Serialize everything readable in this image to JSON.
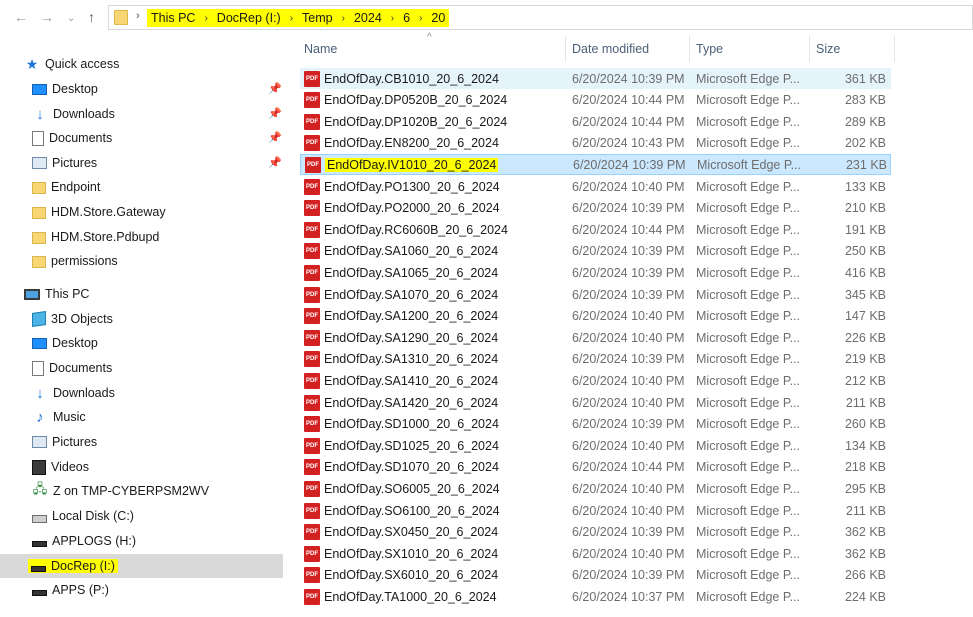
{
  "address_bar": {
    "crumbs": [
      "This PC",
      "DocRep (I:)",
      "Temp",
      "2024",
      "6",
      "20"
    ],
    "separator": "›"
  },
  "nav": {
    "back_icon": "arrow-left-icon",
    "forward_icon": "arrow-right-icon",
    "recent_icon": "chevron-down-icon",
    "up_icon": "arrow-up-icon"
  },
  "sidebar": {
    "quick_access": {
      "label": "Quick access",
      "items": [
        {
          "label": "Desktop",
          "pinned": true,
          "icon": "desktop-icon"
        },
        {
          "label": "Downloads",
          "pinned": true,
          "icon": "downloads-icon"
        },
        {
          "label": "Documents",
          "pinned": true,
          "icon": "documents-icon"
        },
        {
          "label": "Pictures",
          "pinned": true,
          "icon": "pictures-icon"
        },
        {
          "label": "Endpoint",
          "pinned": false,
          "icon": "folder-icon"
        },
        {
          "label": "HDM.Store.Gateway",
          "pinned": false,
          "icon": "folder-icon"
        },
        {
          "label": "HDM.Store.Pdbupd",
          "pinned": false,
          "icon": "folder-icon"
        },
        {
          "label": "permissions",
          "pinned": false,
          "icon": "folder-icon"
        }
      ]
    },
    "this_pc": {
      "label": "This PC",
      "items": [
        {
          "label": "3D Objects",
          "icon": "3d-objects-icon"
        },
        {
          "label": "Desktop",
          "icon": "desktop-icon"
        },
        {
          "label": "Documents",
          "icon": "documents-icon"
        },
        {
          "label": "Downloads",
          "icon": "downloads-icon"
        },
        {
          "label": "Music",
          "icon": "music-icon"
        },
        {
          "label": "Pictures",
          "icon": "pictures-icon"
        },
        {
          "label": "Videos",
          "icon": "videos-icon"
        },
        {
          "label": "Z on TMP-CYBERPSM2WV",
          "icon": "network-drive-icon"
        },
        {
          "label": "Local Disk (C:)",
          "icon": "local-disk-icon"
        },
        {
          "label": "APPLOGS (H:)",
          "icon": "drive-icon"
        },
        {
          "label": "DocRep (I:)",
          "icon": "drive-icon",
          "selected": true
        },
        {
          "label": "APPS (P:)",
          "icon": "drive-icon"
        }
      ]
    }
  },
  "columns": {
    "name": "Name",
    "date": "Date modified",
    "type": "Type",
    "size": "Size"
  },
  "files": [
    {
      "name": "EndOfDay.CB1010_20_6_2024",
      "date": "6/20/2024 10:39 PM",
      "type": "Microsoft Edge P...",
      "size": "361 KB"
    },
    {
      "name": "EndOfDay.DP0520B_20_6_2024",
      "date": "6/20/2024 10:44 PM",
      "type": "Microsoft Edge P...",
      "size": "283 KB"
    },
    {
      "name": "EndOfDay.DP1020B_20_6_2024",
      "date": "6/20/2024 10:44 PM",
      "type": "Microsoft Edge P...",
      "size": "289 KB"
    },
    {
      "name": "EndOfDay.EN8200_20_6_2024",
      "date": "6/20/2024 10:43 PM",
      "type": "Microsoft Edge P...",
      "size": "202 KB"
    },
    {
      "name": "EndOfDay.IV1010_20_6_2024",
      "date": "6/20/2024 10:39 PM",
      "type": "Microsoft Edge P...",
      "size": "231 KB"
    },
    {
      "name": "EndOfDay.PO1300_20_6_2024",
      "date": "6/20/2024 10:40 PM",
      "type": "Microsoft Edge P...",
      "size": "133 KB"
    },
    {
      "name": "EndOfDay.PO2000_20_6_2024",
      "date": "6/20/2024 10:39 PM",
      "type": "Microsoft Edge P...",
      "size": "210 KB"
    },
    {
      "name": "EndOfDay.RC6060B_20_6_2024",
      "date": "6/20/2024 10:44 PM",
      "type": "Microsoft Edge P...",
      "size": "191 KB"
    },
    {
      "name": "EndOfDay.SA1060_20_6_2024",
      "date": "6/20/2024 10:39 PM",
      "type": "Microsoft Edge P...",
      "size": "250 KB"
    },
    {
      "name": "EndOfDay.SA1065_20_6_2024",
      "date": "6/20/2024 10:39 PM",
      "type": "Microsoft Edge P...",
      "size": "416 KB"
    },
    {
      "name": "EndOfDay.SA1070_20_6_2024",
      "date": "6/20/2024 10:39 PM",
      "type": "Microsoft Edge P...",
      "size": "345 KB"
    },
    {
      "name": "EndOfDay.SA1200_20_6_2024",
      "date": "6/20/2024 10:40 PM",
      "type": "Microsoft Edge P...",
      "size": "147 KB"
    },
    {
      "name": "EndOfDay.SA1290_20_6_2024",
      "date": "6/20/2024 10:40 PM",
      "type": "Microsoft Edge P...",
      "size": "226 KB"
    },
    {
      "name": "EndOfDay.SA1310_20_6_2024",
      "date": "6/20/2024 10:39 PM",
      "type": "Microsoft Edge P...",
      "size": "219 KB"
    },
    {
      "name": "EndOfDay.SA1410_20_6_2024",
      "date": "6/20/2024 10:40 PM",
      "type": "Microsoft Edge P...",
      "size": "212 KB"
    },
    {
      "name": "EndOfDay.SA1420_20_6_2024",
      "date": "6/20/2024 10:40 PM",
      "type": "Microsoft Edge P...",
      "size": "211 KB"
    },
    {
      "name": "EndOfDay.SD1000_20_6_2024",
      "date": "6/20/2024 10:39 PM",
      "type": "Microsoft Edge P...",
      "size": "260 KB"
    },
    {
      "name": "EndOfDay.SD1025_20_6_2024",
      "date": "6/20/2024 10:40 PM",
      "type": "Microsoft Edge P...",
      "size": "134 KB"
    },
    {
      "name": "EndOfDay.SD1070_20_6_2024",
      "date": "6/20/2024 10:44 PM",
      "type": "Microsoft Edge P...",
      "size": "218 KB"
    },
    {
      "name": "EndOfDay.SO6005_20_6_2024",
      "date": "6/20/2024 10:40 PM",
      "type": "Microsoft Edge P...",
      "size": "295 KB"
    },
    {
      "name": "EndOfDay.SO6100_20_6_2024",
      "date": "6/20/2024 10:40 PM",
      "type": "Microsoft Edge P...",
      "size": "211 KB"
    },
    {
      "name": "EndOfDay.SX0450_20_6_2024",
      "date": "6/20/2024 10:39 PM",
      "type": "Microsoft Edge P...",
      "size": "362 KB"
    },
    {
      "name": "EndOfDay.SX1010_20_6_2024",
      "date": "6/20/2024 10:40 PM",
      "type": "Microsoft Edge P...",
      "size": "362 KB"
    },
    {
      "name": "EndOfDay.SX6010_20_6_2024",
      "date": "6/20/2024 10:39 PM",
      "type": "Microsoft Edge P...",
      "size": "266 KB"
    },
    {
      "name": "EndOfDay.TA1000_20_6_2024",
      "date": "6/20/2024 10:37 PM",
      "type": "Microsoft Edge P...",
      "size": "224 KB"
    }
  ],
  "colors": {
    "highlight": "#ffff00",
    "selection_bg": "#cce8ff",
    "hover_bg": "#e5f3fb",
    "pdf_icon": "#d32121",
    "header_text": "#4c607a"
  }
}
